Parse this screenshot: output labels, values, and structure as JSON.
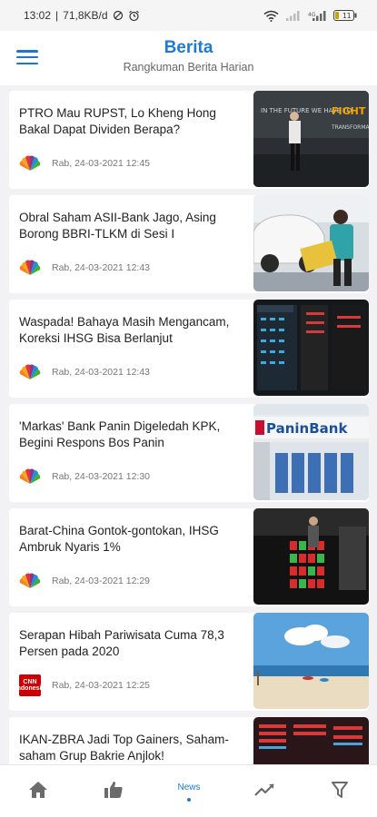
{
  "status_bar": {
    "time": "13:02",
    "speed": "71,8KB/d",
    "battery": "11"
  },
  "header": {
    "title": "Berita",
    "subtitle": "Rangkuman Berita Harian"
  },
  "news": [
    {
      "title": "PTRO Mau RUPST, Lo Kheng Hong Bakal Dapat Dividen Berapa?",
      "meta": "Rab, 24-03-2021 12:45",
      "source_icon": "cnbc-peacock-icon",
      "thumb": "speaker-fight-for-stage"
    },
    {
      "title": "Obral Saham ASII-Bank Jago, Asing Borong BBRI-TLKM di Sesi I",
      "meta": "Rab, 24-03-2021 12:43",
      "source_icon": "cnbc-peacock-icon",
      "thumb": "car-showroom-woman"
    },
    {
      "title": "Waspada! Bahaya Masih Mengancam, Koreksi IHSG Bisa Berlanjut",
      "meta": "Rab, 24-03-2021 12:43",
      "source_icon": "cnbc-peacock-icon",
      "thumb": "stock-board-dark"
    },
    {
      "title": "'Markas' Bank Panin Digeledah KPK, Begini Respons Bos Panin",
      "meta": "Rab, 24-03-2021 12:30",
      "source_icon": "cnbc-peacock-icon",
      "thumb": "panin-bank-building",
      "thumb_text": "PaninBank"
    },
    {
      "title": "Barat-China Gontok-gontokan, IHSG Ambruk Nyaris 1%",
      "meta": "Rab, 24-03-2021 12:29",
      "source_icon": "cnbc-peacock-icon",
      "thumb": "stock-display-red-green"
    },
    {
      "title": "Serapan Hibah Pariwisata Cuma 78,3 Persen pada 2020",
      "meta": "Rab, 24-03-2021 12:25",
      "source_icon": "cnn-icon",
      "source_text": "CNN Indonesia",
      "thumb": "beach-scene"
    },
    {
      "title": "IKAN-ZBRA Jadi Top Gainers, Saham-saham Grup Bakrie Anjlok!",
      "meta": "",
      "source_icon": "cnbc-peacock-icon",
      "thumb": "stock-board-red"
    }
  ],
  "nav": {
    "home": "home-icon",
    "like": "thumbs-up-icon",
    "news_label": "News",
    "chart": "trend-icon",
    "filter": "filter-icon"
  },
  "colors": {
    "accent": "#1e7ad4",
    "background": "#f2f2f4",
    "card": "#ffffff"
  }
}
